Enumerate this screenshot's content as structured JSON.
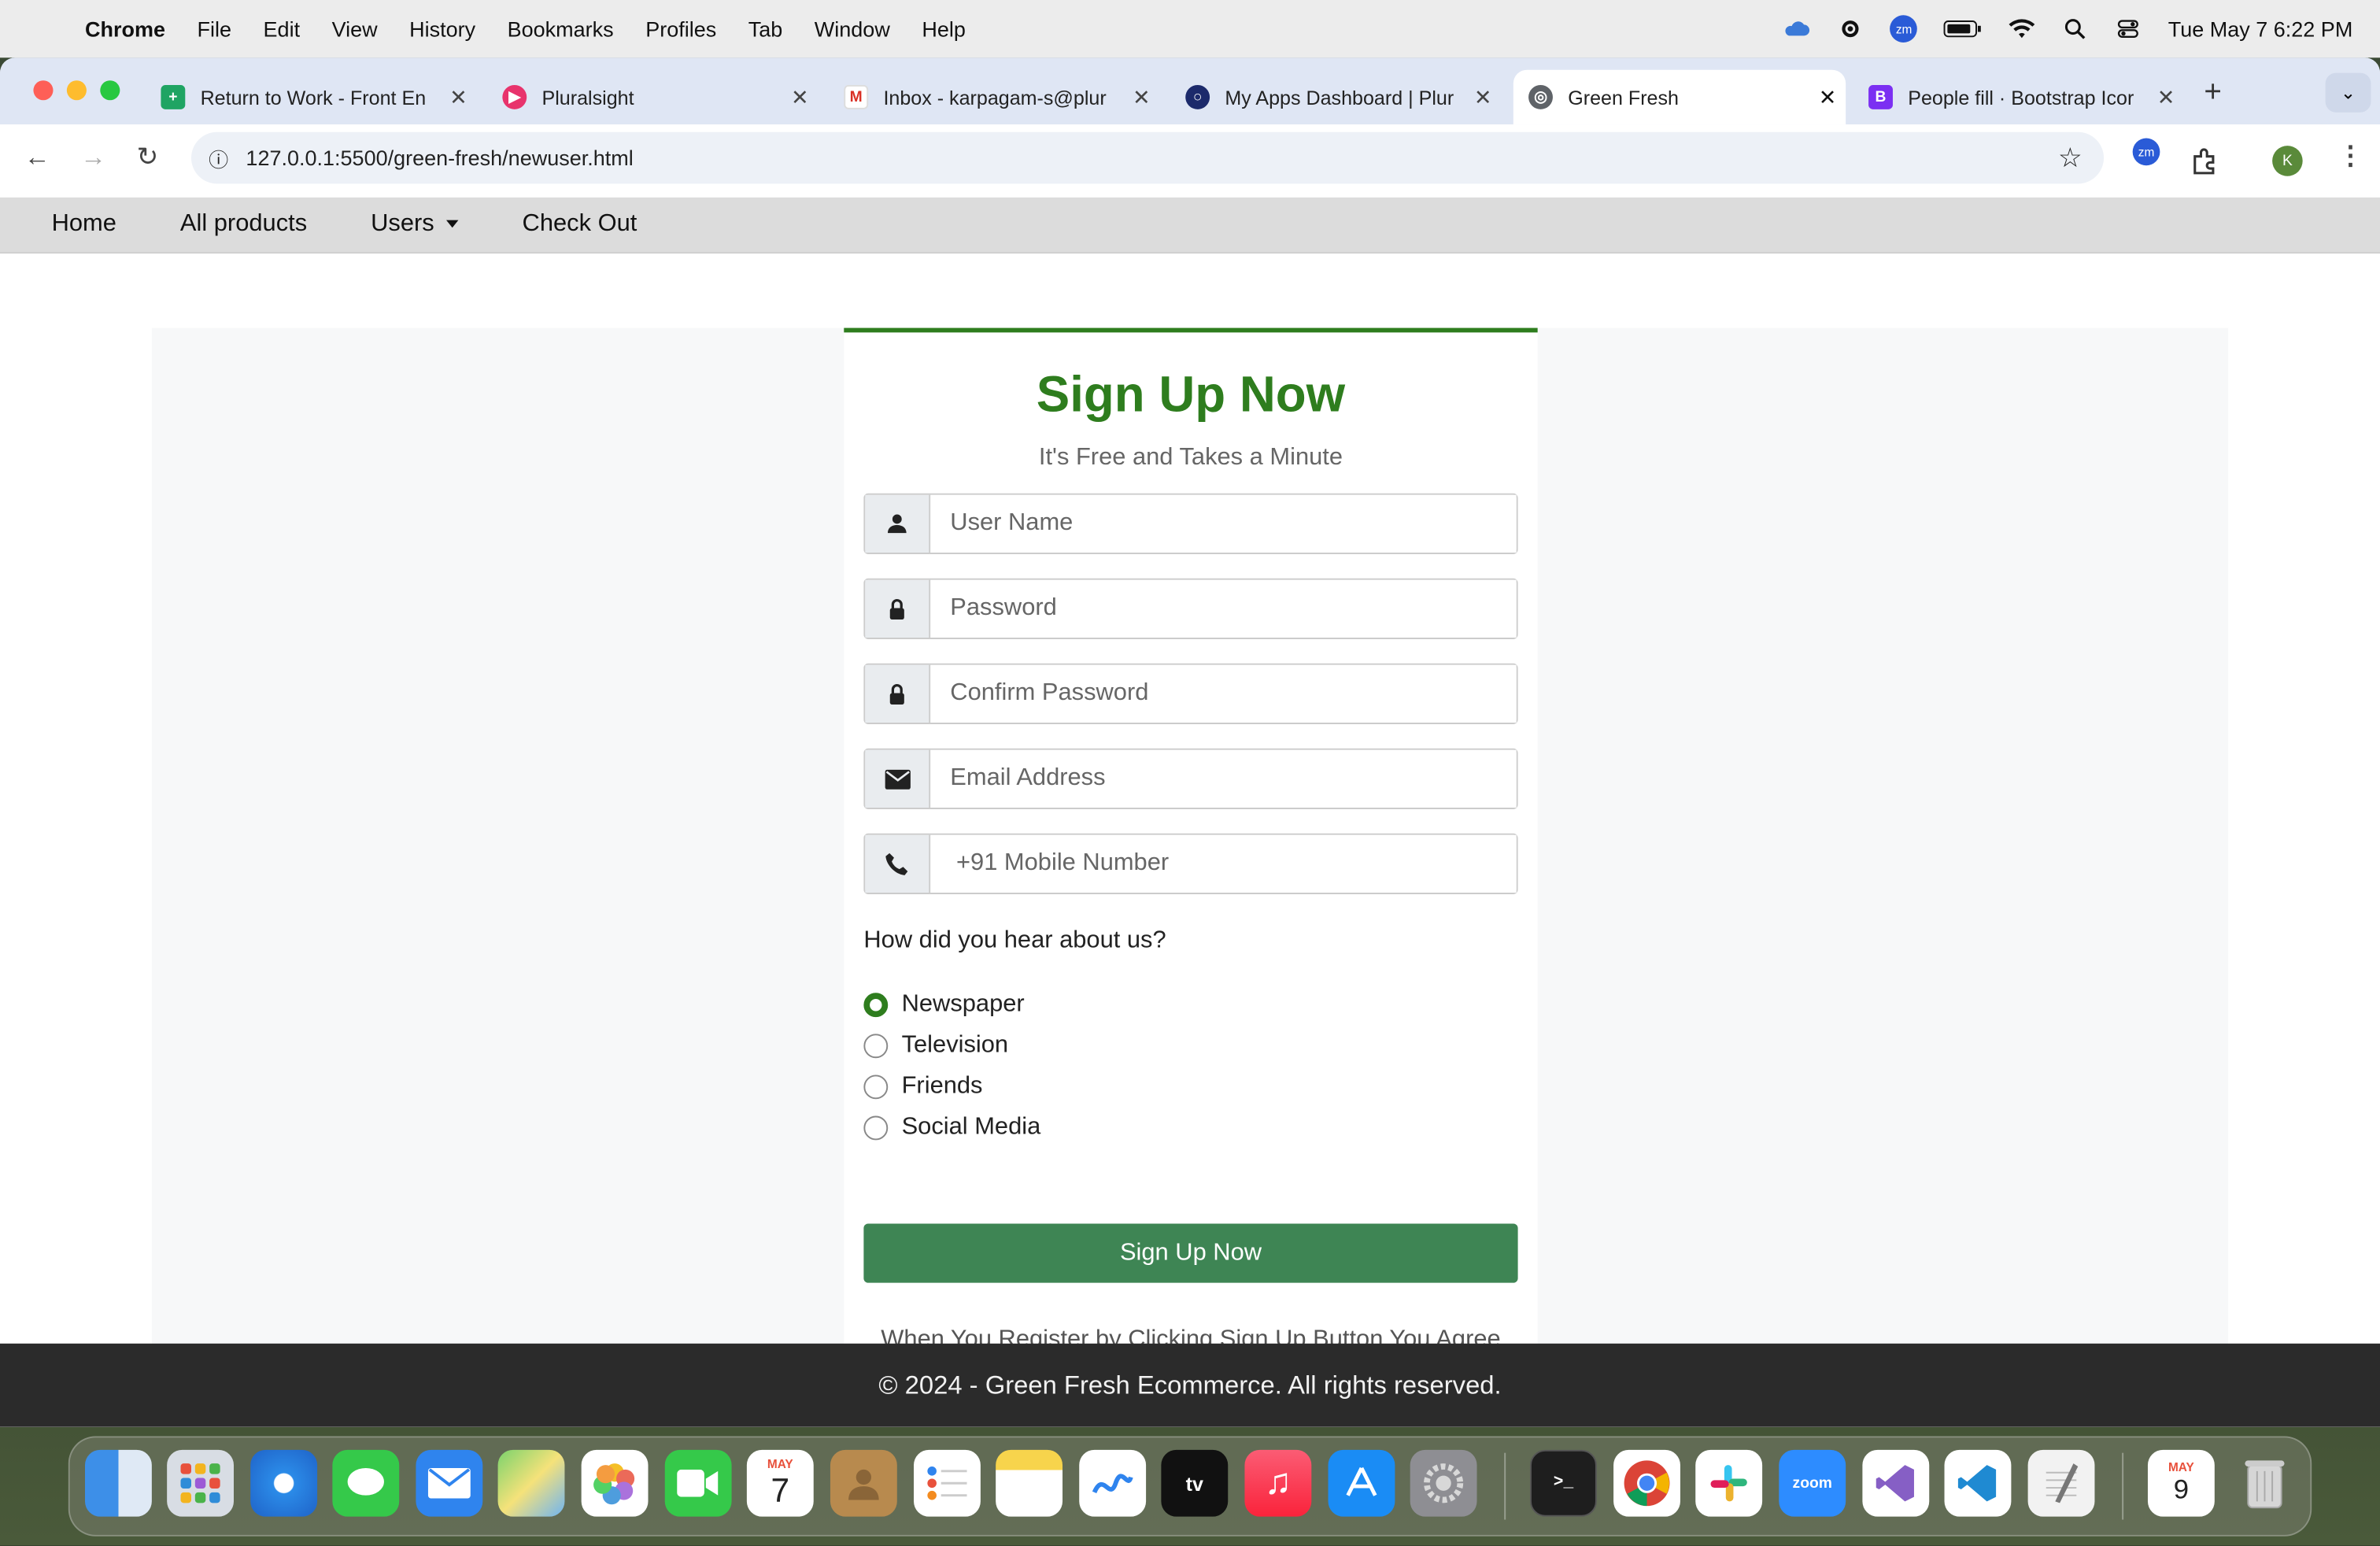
{
  "menubar": {
    "app": "Chrome",
    "items": [
      "File",
      "Edit",
      "View",
      "History",
      "Bookmarks",
      "Profiles",
      "Tab",
      "Window",
      "Help"
    ],
    "datetime": "Tue May 7  6:22 PM",
    "zoom_badge": "zm"
  },
  "tabs": [
    {
      "label": "Return to Work - Front En",
      "color": "#1fa463",
      "glyph": "+"
    },
    {
      "label": "Pluralsight",
      "color": "#e8336c",
      "glyph": "▶"
    },
    {
      "label": "Inbox - karpagam-s@plur",
      "color": "#ffffff",
      "glyph": "M"
    },
    {
      "label": "My Apps Dashboard | Plur",
      "color": "#1c2a6b",
      "glyph": "○"
    },
    {
      "label": "Green Fresh",
      "color": "#5f6368",
      "glyph": "◎"
    },
    {
      "label": "People fill · Bootstrap Icor",
      "color": "#7b2ff2",
      "glyph": "B"
    }
  ],
  "toolbar": {
    "url": "127.0.0.1:5500/green-fresh/newuser.html",
    "zoom_badge": "zm",
    "profile_initial": "K"
  },
  "site": {
    "nav": {
      "home": "Home",
      "products": "All products",
      "users": "Users",
      "checkout": "Check Out"
    },
    "form": {
      "title": "Sign Up Now",
      "subtitle": "It's Free and Takes a Minute",
      "username_ph": "User Name",
      "password_ph": "Password",
      "confirm_ph": "Confirm Password",
      "email_ph": "Email Address",
      "mobile_ph": "+91 Mobile Number",
      "question": "How did you hear about us?",
      "options": [
        "Newspaper",
        "Television",
        "Friends",
        "Social Media"
      ],
      "selected": "Newspaper",
      "submit": "Sign Up Now",
      "terms": "When You Register by Clicking Sign Up Button You Agree"
    },
    "footer": "© 2024 - Green Fresh Ecommerce. All rights reserved.",
    "accent": "#2e7d1e",
    "button_color": "#3e8554"
  },
  "dock": {
    "calendar_month": "MAY",
    "calendar_day": "7",
    "calendar2_day": "9",
    "zoom_label": "zoom",
    "appletv_label": "tv"
  }
}
